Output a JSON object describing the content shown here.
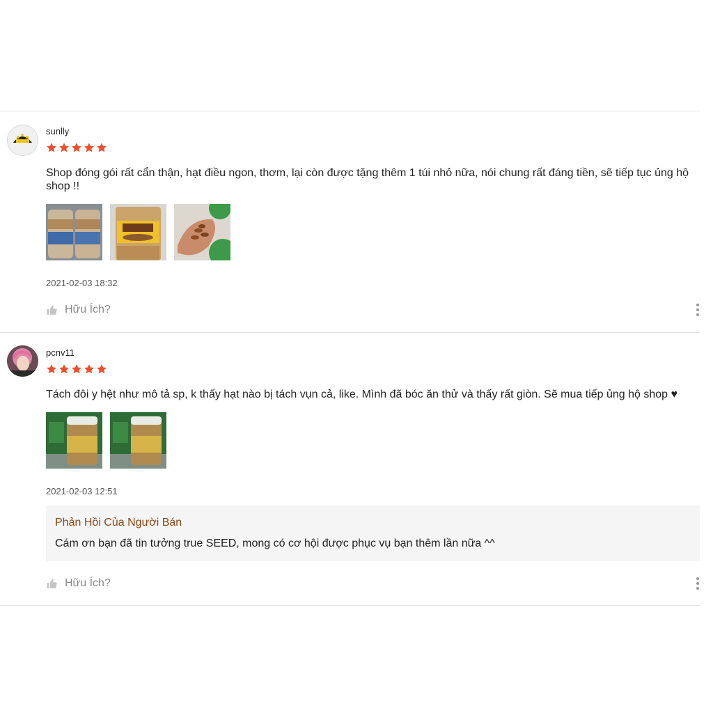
{
  "reviews": [
    {
      "username": "sunlly",
      "rating": 5,
      "text": "Shop đóng gói rất cẩn thận, hạt điều ngon, thơm, lại còn được tặng thêm 1 túi nhỏ nữa, nói chung rất đáng tiền, sẽ tiếp tục ủng hộ shop !!",
      "timestamp": "2021-02-03 18:32",
      "helpful_label": "Hữu Ích?"
    },
    {
      "username": "pcnv11",
      "rating": 5,
      "text": "Tách đôi y hệt như mô tả sp, k thấy hạt nào bị tách vụn cả, like. Mình đã bóc ăn thử và thấy rất giòn. Sẽ mua tiếp ủng hộ shop ♥",
      "timestamp": "2021-02-03 12:51",
      "seller_reply": {
        "title": "Phản Hồi Của Người Bán",
        "text": "Cám ơn bạn đã tin tưởng true SEED, mong có cơ hội được phục vụ bạn thêm lần nữa ^^"
      },
      "helpful_label": "Hữu Ích?"
    }
  ],
  "colors": {
    "star": "#ee4d2d",
    "reply_title": "#8b4513"
  },
  "icons": {
    "star": "star-icon",
    "like": "thumbs-up-icon",
    "more": "more-vertical-icon"
  }
}
